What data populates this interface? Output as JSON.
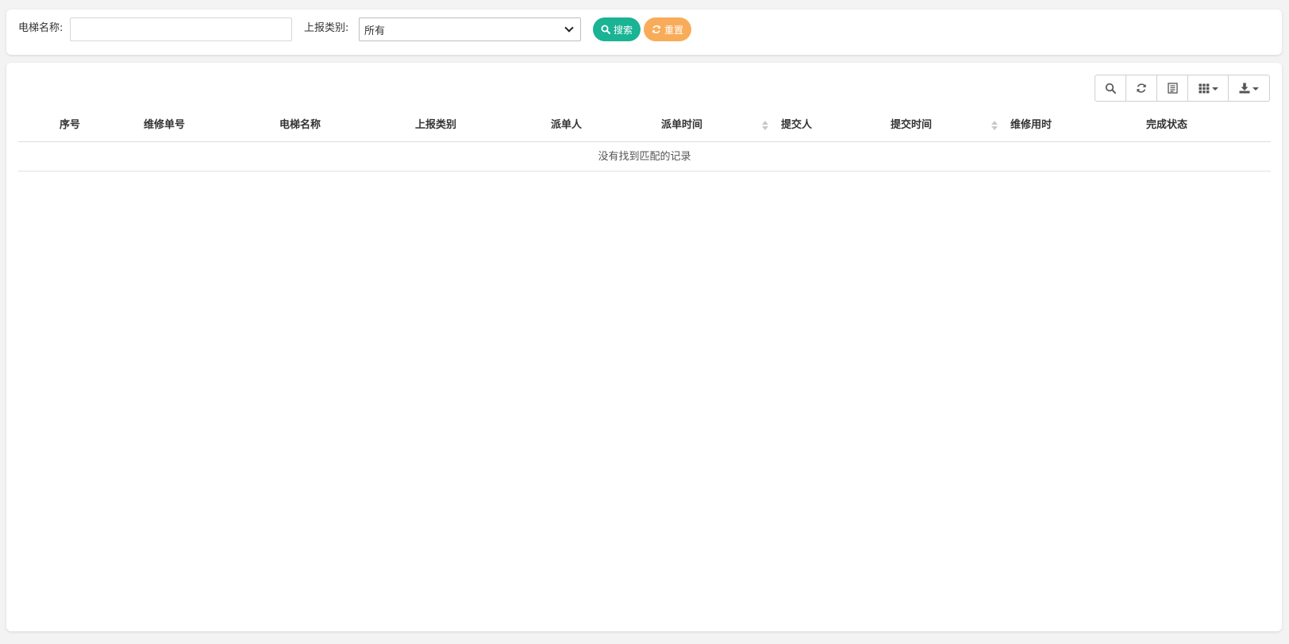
{
  "search": {
    "elevator_name_label": "电梯名称:",
    "elevator_name_value": "",
    "report_type_label": "上报类别:",
    "report_type_selected": "所有",
    "search_button": "搜索",
    "reset_button": "重置",
    "colors": {
      "search": "#1ab394",
      "reset": "#f8ac59"
    }
  },
  "toolbar": {
    "icons": [
      "search-icon",
      "refresh-icon",
      "detail-icon",
      "columns-icon",
      "export-icon"
    ]
  },
  "table": {
    "columns": [
      "序号",
      "维修单号",
      "电梯名称",
      "上报类别",
      "派单人",
      "派单时间",
      "提交人",
      "提交时间",
      "维修用时",
      "完成状态"
    ],
    "empty_message": "没有找到匹配的记录"
  }
}
